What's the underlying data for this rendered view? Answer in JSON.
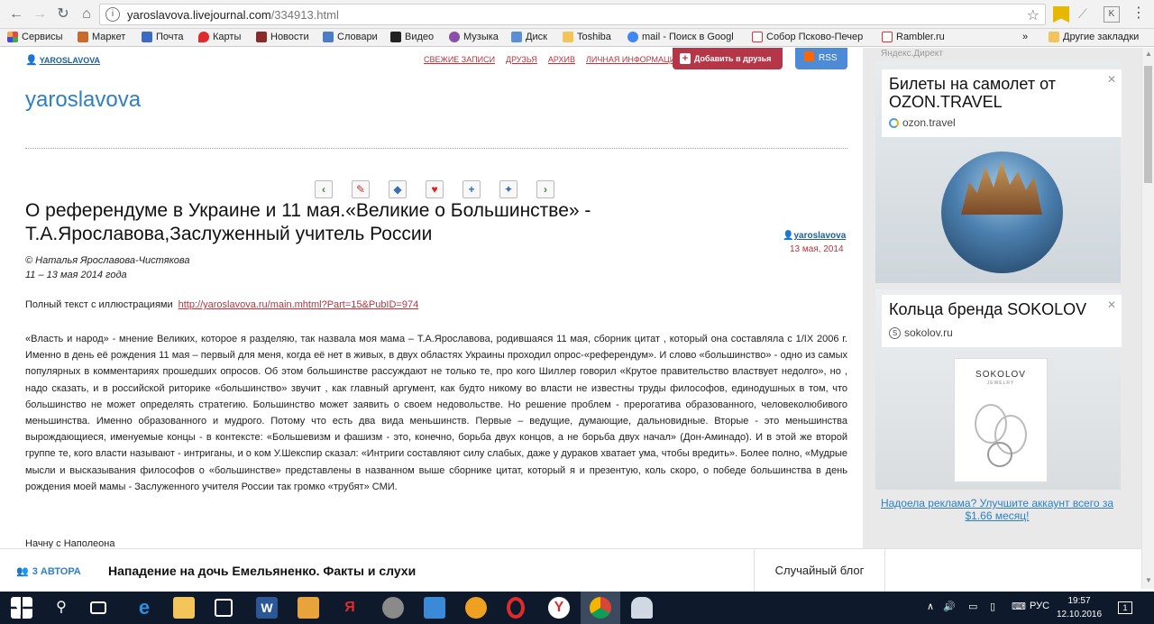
{
  "browser": {
    "url_host": "yaroslavova.livejournal.com",
    "url_path": "/334913.html",
    "bookmarks": [
      "Сервисы",
      "Маркет",
      "Почта",
      "Карты",
      "Новости",
      "Словари",
      "Видео",
      "Музыка",
      "Диск",
      "Toshiba",
      "mail - Поиск в Googl",
      "Собор Псково-Печер",
      "Rambler.ru"
    ],
    "bookmarks_overflow": "»",
    "other_bookmarks": "Другие закладки"
  },
  "header": {
    "user": "YAROSLAVOVA",
    "nav": [
      "СВЕЖИЕ ЗАПИСИ",
      "ДРУЗЬЯ",
      "АРХИВ",
      "ЛИЧНАЯ ИНФОРМАЦИЯ"
    ],
    "add_friend": "Добавить в друзья",
    "rss": "RSS",
    "blog_title": "yaroslavova"
  },
  "post": {
    "title": "О референдуме в Украине и 11 мая.«Великие о Большинстве» - Т.А.Ярославова,Заслуженный учитель России",
    "author": "yaroslavova",
    "date": "13 мая, 2014",
    "copyright": "© Наталья Ярославова-Чистякова",
    "period": "11 – 13 мая 2014 года",
    "fulltext_label": "Полный  текст  с иллюстрациями",
    "fulltext_link": "http://yaroslavova.ru/main.mhtml?Part=15&PubID=974",
    "body": "«Власть и народ» - мнение  Великих, которое  я  разделяю, так  назвала моя  мама – Т.А.Ярославова,  родившаяся   11 мая,    сборник цитат ,  который  она  составляла  с 1/IX 2006 г. Именно    в   день   её рождения    11 мая – первый  для меня, когда её  нет  в живых, в двух  областях   Украины  проходил  опрос-«референдум». И слово «большинство» - одно из самых популярных   в комментариях прошедших   опросов. Об этом   большинстве    рассуждают  не только те,      про кого Шиллер  говорил «Крутое правительство  властвует    недолго», но ,  надо  сказать,  и в российской  риторике    «большинство»  звучит , как  главный  аргумент,  как   будто    никому  во власти не известны   труды   философов,  единодушных в  том, что   большинство не  может  определять стратегию.  Большинство может заявить о своем   недовольстве.  Но решение  проблем   -  прерогатива  образованного, человеколюбивого  меньшинства. Именно  образованного и мудрого.  Потому что есть два  вида  меньшинств. Первые – ведущие, думающие, дальновидные.  Вторые  - это  меньшинства вырождающиеся, именуемые концы -  в контексте: «Большевизм и  фашизм  - это, конечно, борьба  двух концов,  а не  борьба  двух начал» (Дон-Аминадо). И в  этой  же второй группе те, кого власти называют    - интриганы, и  о ком У.Шекспир сказал: «Интриги  составляют силу  слабых,  даже  у  дураков  хватает ума, чтобы вредить».    Более  полно,  «Мудрые  мысли и высказывания  философов о «большинстве»   представлены  в   названном выше  сборнике цитат, который   я и презентую,  коль скоро,   о победе  большинства в  день   рождения моей  мамы  - Заслуженного  учителя  России так  громко   «трубят»   СМИ.",
    "tail": "Начну  с    Наполеона"
  },
  "sidebar": {
    "ad_label": "Яндекс.Директ",
    "ad1": {
      "title": "Билеты на самолет от OZON.TRAVEL",
      "domain": "ozon.travel"
    },
    "ad2": {
      "title": "Кольца бренда SOKOLOV",
      "domain": "sokolov.ru",
      "brand": "SOKOLOV",
      "brand_sub": "JEWELRY"
    },
    "promo": "Надоела реклама? Улучшите аккаунт всего за $1.66 месяц!"
  },
  "bottom": {
    "authors": "3 АВТОРА",
    "headline": "Нападение на дочь Емельяненко. Факты и слухи",
    "random_blog": "Случайный блог"
  },
  "taskbar": {
    "lang": "РУС",
    "time": "19:57",
    "date": "12.10.2016",
    "notifications": "1"
  },
  "colors": {
    "accent": "#b53747",
    "link_blue": "#2e7fc5",
    "rss_blue": "#4d8bd6",
    "taskbar": "#0e1a2c"
  }
}
